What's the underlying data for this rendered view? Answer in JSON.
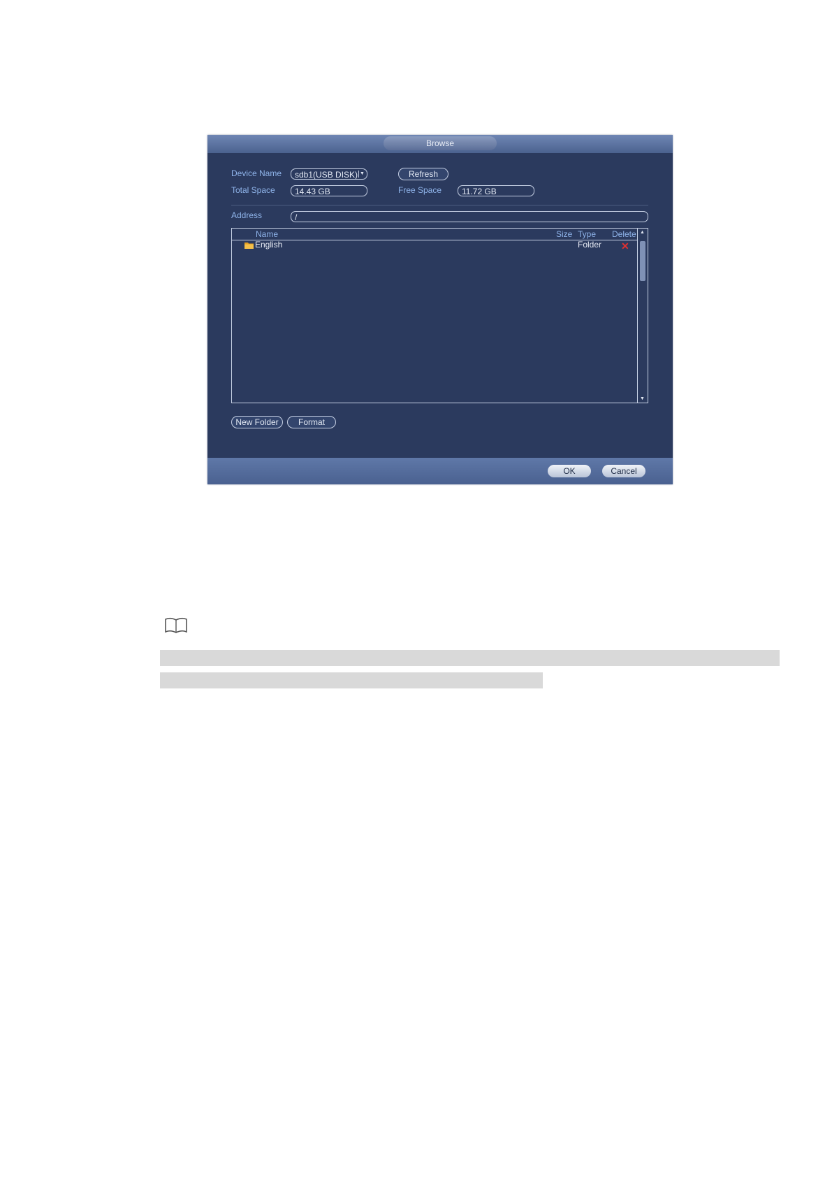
{
  "dialog": {
    "title": "Browse",
    "device_name_label": "Device Name",
    "device_name_value": "sdb1(USB DISK)",
    "refresh_label": "Refresh",
    "total_space_label": "Total Space",
    "total_space_value": "14.43 GB",
    "free_space_label": "Free Space",
    "free_space_value": "11.72 GB",
    "address_label": "Address",
    "address_value": "/",
    "columns": {
      "name": "Name",
      "size": "Size",
      "type": "Type",
      "delete": "Delete"
    },
    "files": [
      {
        "name": "English",
        "size": "",
        "type": "Folder"
      }
    ],
    "new_folder_label": "New Folder",
    "format_label": "Format",
    "ok_label": "OK",
    "cancel_label": "Cancel"
  },
  "icons": {
    "folder": "folder-icon",
    "delete": "delete-x-icon",
    "note": "book-note-icon"
  },
  "colors": {
    "dialog_bg": "#2b3a5e",
    "label_blue": "#8fb4ea",
    "delete_red": "#e23030",
    "highlight_gray": "#d9d9d9"
  }
}
